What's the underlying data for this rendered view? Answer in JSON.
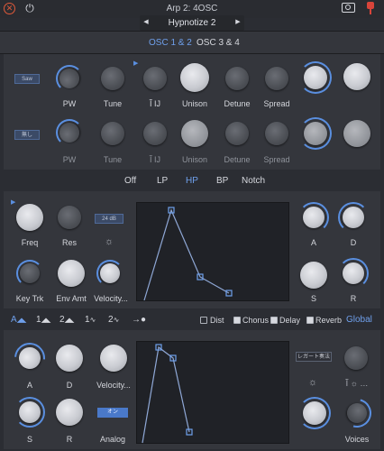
{
  "header": {
    "title": "Arp 2: 4OSC",
    "preset_name": "Hypnotize 2",
    "prev_arrow": "◀",
    "next_arrow": "▶"
  },
  "osc_tabs": [
    {
      "label": "OSC 1 & 2",
      "active": true
    },
    {
      "label": "OSC 3 & 4",
      "active": false
    }
  ],
  "osc1": {
    "wave": "Saw",
    "labels": [
      "PW",
      "Tune",
      "",
      "Unison",
      "Detune",
      "Spread"
    ]
  },
  "osc2": {
    "wave": "無し",
    "labels": [
      "PW",
      "Tune",
      "",
      "Unison",
      "Detune",
      "Spread"
    ]
  },
  "filter_types": [
    "Off",
    "LP",
    "HP",
    "BP",
    "Notch"
  ],
  "filter_active": "HP",
  "filter": {
    "slope": "24 dB",
    "labels": {
      "freq": "Freq",
      "res": "Res",
      "keytrk": "Key Trk",
      "envamt": "Env Amt",
      "velocity": "Velocity..."
    },
    "env_labels": {
      "a": "A",
      "d": "D",
      "s": "S",
      "r": "R"
    }
  },
  "mod_row": {
    "tabs": [
      "A",
      "1",
      "2",
      "1",
      "2"
    ],
    "checks": [
      {
        "label": "Dist",
        "on": false
      },
      {
        "label": "Chorus",
        "on": true
      },
      {
        "label": "Delay",
        "on": true
      },
      {
        "label": "Reverb",
        "on": true
      }
    ],
    "global": "Global"
  },
  "amp": {
    "labels": {
      "a": "A",
      "d": "D",
      "velocity": "Velocity...",
      "s": "S",
      "r": "R",
      "analog": "Analog",
      "voices": "Voices"
    },
    "analog_btn": "オン",
    "legato_btn": "レガート奏法"
  },
  "colors": {
    "accent": "#5a8fe0",
    "header_close": "#e05a3a",
    "pin_red": "#d9443a"
  }
}
